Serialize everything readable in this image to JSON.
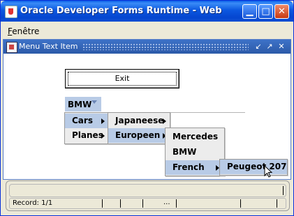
{
  "window": {
    "title": "Oracle Developer Forms Runtime - Web",
    "minimize": "▁",
    "maximize": "□",
    "close": "✕"
  },
  "menubar": {
    "item_label_underlined": "F",
    "item_label_rest": "enêtre"
  },
  "inner_window": {
    "title": "Menu Text Item",
    "ctrl_minimize": "↙",
    "ctrl_maximize": "↗",
    "ctrl_close": "✕"
  },
  "exit_button": {
    "label": "Exit"
  },
  "menu_bar_item": {
    "label": "BMW"
  },
  "menus": {
    "level1": [
      {
        "label": "Cars",
        "has_submenu": true,
        "selected": true
      },
      {
        "label": "Planes",
        "has_submenu": true,
        "selected": false
      }
    ],
    "level2": [
      {
        "label": "Japaneese",
        "has_submenu": true,
        "selected": false
      },
      {
        "label": "Europeen",
        "has_submenu": true,
        "selected": true
      }
    ],
    "level3": [
      {
        "label": "Mercedes",
        "has_submenu": false,
        "selected": false
      },
      {
        "label": "BMW",
        "has_submenu": false,
        "selected": false
      },
      {
        "label": "French",
        "has_submenu": true,
        "selected": true
      }
    ],
    "level4": [
      {
        "label": "Peugeot 207",
        "has_submenu": false,
        "selected": true
      }
    ]
  },
  "status": {
    "record": "Record: 1/1",
    "ellipsis": "..."
  },
  "colors": {
    "selection": "#b8cbe6",
    "titlebar": "#0546d0",
    "inner_titlebar": "#2c5aa8"
  }
}
